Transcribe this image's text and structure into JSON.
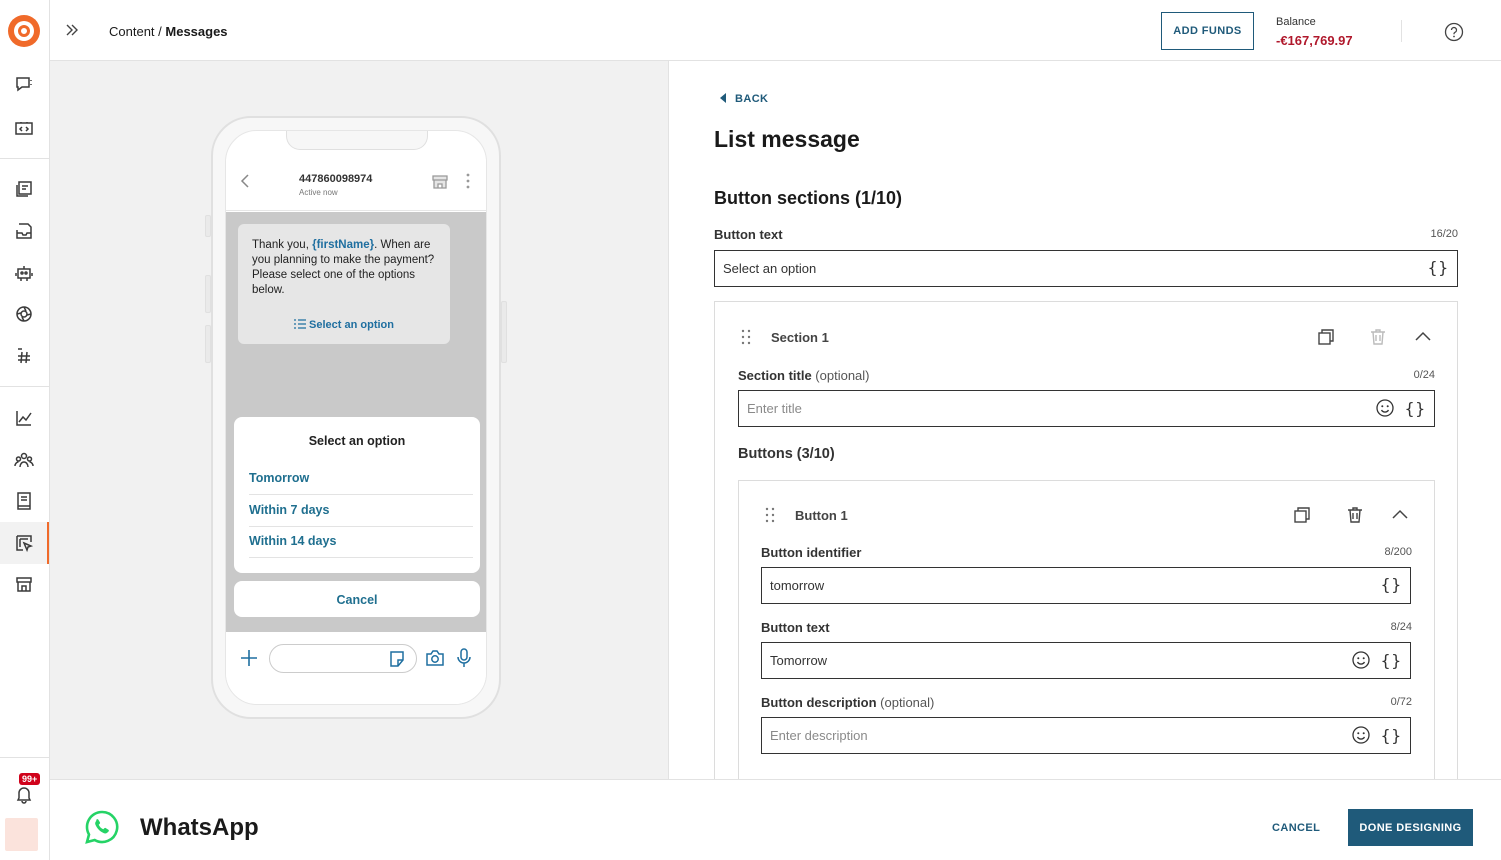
{
  "topbar": {
    "breadcrumb_parent": "Content",
    "breadcrumb_separator": " / ",
    "breadcrumb_current": "Messages",
    "add_funds_label": "ADD FUNDS",
    "balance_label": "Balance",
    "balance_value": "-€167,769.97"
  },
  "sidebar": {
    "notification_badge": "99+",
    "icons": [
      "chat-bubble-icon",
      "code-box-icon",
      "reports-icon",
      "inbox-icon",
      "bot-icon",
      "aperture-icon",
      "hashtag-icon",
      "analytics-icon",
      "people-icon",
      "book-icon",
      "content-icon",
      "store-icon",
      "bell-icon"
    ]
  },
  "preview": {
    "contact_number": "447860098974",
    "contact_status": "Active now",
    "bubble_text_before": "Thank you, ",
    "bubble_variable": "{firstName}",
    "bubble_text_after": ". When are you planning to make the payment? Please select one of the options below.",
    "bubble_select": "Select an option",
    "sheet_title": "Select an option",
    "options": [
      "Tomorrow",
      "Within 7 days",
      "Within 14 days"
    ],
    "cancel_label": "Cancel"
  },
  "editor": {
    "back_label": "BACK",
    "title": "List message",
    "sections_heading": "Button sections (1/10)",
    "button_text_label": "Button text",
    "button_text_counter": "16/20",
    "button_text_value": "Select an option",
    "section": {
      "name": "Section 1",
      "title_label": "Section title",
      "title_optional": " (optional)",
      "title_counter": "0/24",
      "title_placeholder": "Enter title",
      "buttons_heading": "Buttons (3/10)",
      "button": {
        "name": "Button 1",
        "identifier_label": "Button identifier",
        "identifier_counter": "8/200",
        "identifier_value": "tomorrow",
        "text_label": "Button text",
        "text_counter": "8/24",
        "text_value": "Tomorrow",
        "description_label": "Button description",
        "description_optional": " (optional)",
        "description_counter": "0/72",
        "description_placeholder": "Enter description"
      }
    }
  },
  "bottombar": {
    "channel_name": "WhatsApp",
    "cancel_label": "CANCEL",
    "done_label": "DONE DESIGNING"
  },
  "colors": {
    "accent": "#1f5a7a",
    "brand": "#f06a2a",
    "negative_balance": "#b0182c",
    "whatsapp": "#25d366"
  }
}
